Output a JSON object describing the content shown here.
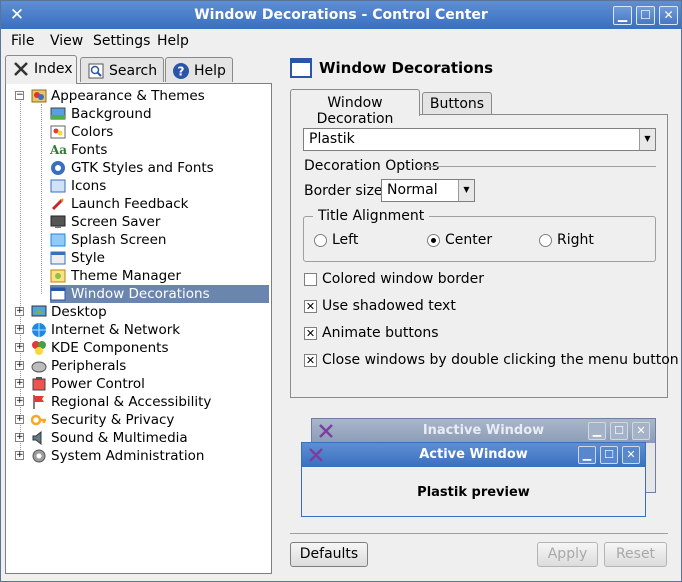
{
  "window": {
    "title": "Window Decorations - Control Center"
  },
  "menubar": {
    "items": [
      "File",
      "View",
      "Settings",
      "Help"
    ]
  },
  "left_tabs": [
    {
      "label": "Index",
      "icon": "index-icon"
    },
    {
      "label": "Search",
      "icon": "search-icon"
    },
    {
      "label": "Help",
      "icon": "help-icon"
    }
  ],
  "tree": {
    "appearance": {
      "label": "Appearance & Themes",
      "icon": "appearance-themes-icon",
      "children": [
        {
          "label": "Background",
          "icon": "background-icon"
        },
        {
          "label": "Colors",
          "icon": "colors-icon"
        },
        {
          "label": "Fonts",
          "icon": "fonts-icon",
          "icon_text": "Aa"
        },
        {
          "label": "GTK Styles and Fonts",
          "icon": "gtk-icon"
        },
        {
          "label": "Icons",
          "icon": "icons-icon"
        },
        {
          "label": "Launch Feedback",
          "icon": "launch-feedback-icon"
        },
        {
          "label": "Screen Saver",
          "icon": "screen-saver-icon"
        },
        {
          "label": "Splash Screen",
          "icon": "splash-screen-icon"
        },
        {
          "label": "Style",
          "icon": "style-icon"
        },
        {
          "label": "Theme Manager",
          "icon": "theme-manager-icon"
        },
        {
          "label": "Window Decorations",
          "icon": "window-decorations-icon",
          "selected": true
        }
      ]
    },
    "categories": [
      {
        "label": "Desktop",
        "icon": "desktop-icon"
      },
      {
        "label": "Internet & Network",
        "icon": "internet-network-icon"
      },
      {
        "label": "KDE Components",
        "icon": "kde-components-icon"
      },
      {
        "label": "Peripherals",
        "icon": "peripherals-icon"
      },
      {
        "label": "Power Control",
        "icon": "power-control-icon"
      },
      {
        "label": "Regional & Accessibility",
        "icon": "regional-accessibility-icon"
      },
      {
        "label": "Security & Privacy",
        "icon": "security-privacy-icon"
      },
      {
        "label": "Sound & Multimedia",
        "icon": "sound-multimedia-icon"
      },
      {
        "label": "System Administration",
        "icon": "system-administration-icon"
      }
    ]
  },
  "module": {
    "title": "Window Decorations",
    "icon": "window-decorations-icon"
  },
  "module_tabs": [
    "Window Decoration",
    "Buttons"
  ],
  "decoration": {
    "selected": "Plastik",
    "options_title": "Decoration Options",
    "border_size_label": "Border size:",
    "border_size_value": "Normal",
    "title_alignment_label": "Title Alignment",
    "alignment_options": [
      "Left",
      "Center",
      "Right"
    ],
    "alignment_selected": "Center",
    "checkboxes": [
      {
        "label": "Colored window border",
        "checked": false
      },
      {
        "label": "Use shadowed text",
        "checked": true
      },
      {
        "label": "Animate buttons",
        "checked": true
      },
      {
        "label": "Close windows by double clicking the menu button",
        "checked": true
      }
    ]
  },
  "preview": {
    "inactive_title": "Inactive Window",
    "active_title": "Active Window",
    "body_text": "Plastik preview"
  },
  "buttons": {
    "defaults": "Defaults",
    "apply": "Apply",
    "reset": "Reset"
  },
  "colors": {
    "titlebar": "#4a7ecb",
    "selection": "#6b86ae",
    "inactive_titlebar": "#9aa9c1"
  }
}
